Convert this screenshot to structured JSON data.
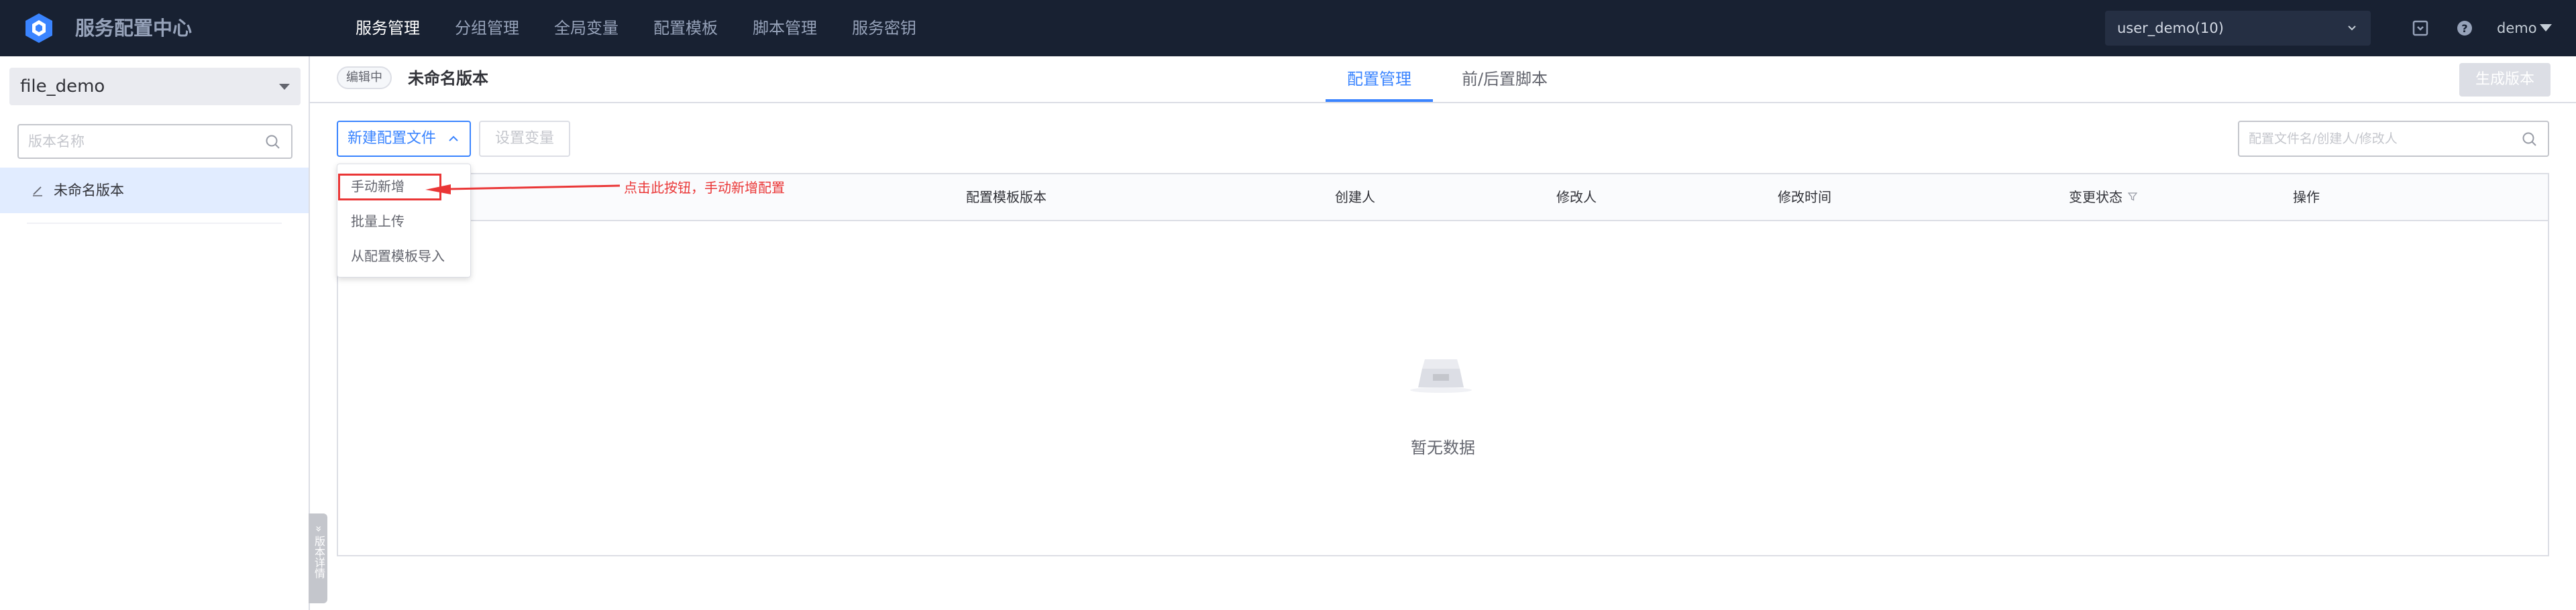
{
  "app": {
    "title": "服务配置中心",
    "logo_icon": "hexagon-logo-icon",
    "accent_color": "#3a84ff"
  },
  "topnav": {
    "items": [
      {
        "label": "服务管理",
        "active": true
      },
      {
        "label": "分组管理",
        "active": false
      },
      {
        "label": "全局变量",
        "active": false
      },
      {
        "label": "配置模板",
        "active": false
      },
      {
        "label": "脚本管理",
        "active": false
      },
      {
        "label": "服务密钥",
        "active": false
      }
    ],
    "user_selector": "user_demo(10)",
    "icons": [
      "switch-icon",
      "help-icon"
    ],
    "username": "demo"
  },
  "sidebar": {
    "service_selector": "file_demo",
    "version_search_placeholder": "版本名称",
    "versions": [
      {
        "label": "未命名版本",
        "icon": "edit-pencil-icon",
        "selected": true
      }
    ],
    "collapse_toggle_label": "» 版本详情"
  },
  "main": {
    "status_tag": "编辑中",
    "version_title": "未命名版本",
    "tabs": [
      {
        "label": "配置管理",
        "active": true
      },
      {
        "label": "前/后置脚本",
        "active": false
      }
    ],
    "generate_button": "生成版本"
  },
  "toolbar": {
    "new_file_button": "新建配置文件",
    "set_vars_button": "设置变量",
    "search_placeholder": "配置文件名/创建人/修改人"
  },
  "dropdown": {
    "items": [
      "手动新增",
      "批量上传",
      "从配置模板导入"
    ]
  },
  "table": {
    "columns": [
      "",
      "配置模板版本",
      "创建人",
      "修改人",
      "修改时间",
      "变更状态",
      "操作"
    ],
    "rows": [],
    "empty_text": "暂无数据"
  },
  "annotation": {
    "text": "点击此按钮，手动新增配置",
    "color": "#ea3636"
  }
}
